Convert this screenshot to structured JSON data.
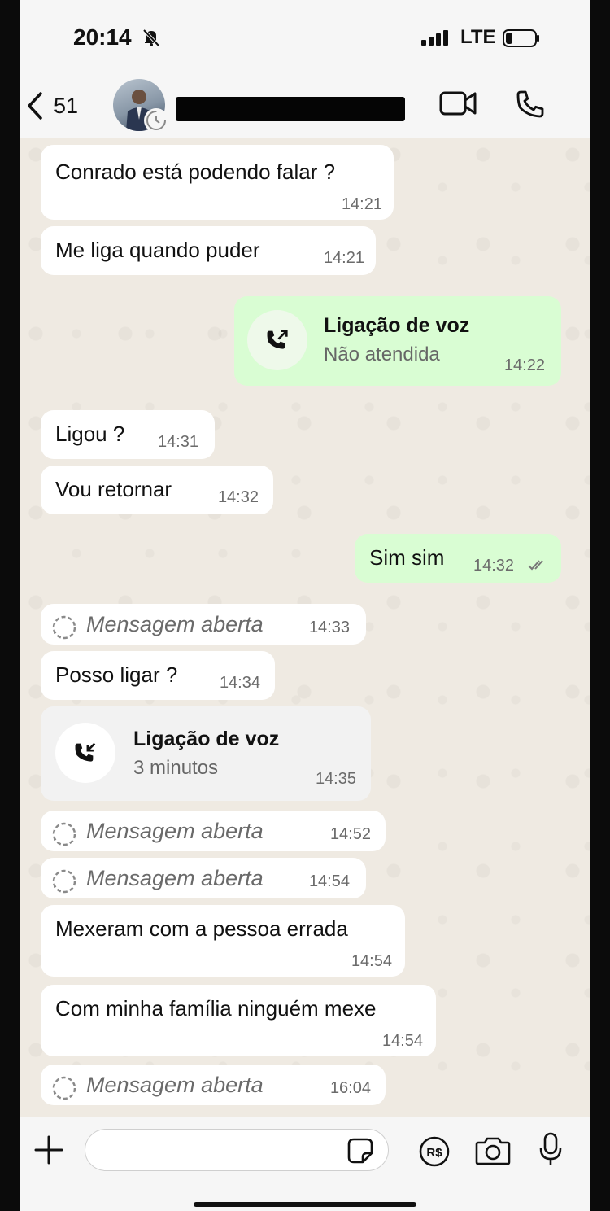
{
  "status_bar": {
    "time": "20:14",
    "network": "LTE"
  },
  "header": {
    "back_count": "51"
  },
  "messages": [
    {
      "type": "text",
      "text": "Conrado está podendo falar ?",
      "time": "14:21"
    },
    {
      "type": "text",
      "text": "Me liga quando puder",
      "time": "14:21"
    },
    {
      "type": "call_out",
      "title": "Ligação de voz",
      "subtitle": "Não atendida",
      "time": "14:22"
    },
    {
      "type": "text",
      "text": "Ligou ?",
      "time": "14:31"
    },
    {
      "type": "text",
      "text": "Vou retornar",
      "time": "14:32"
    },
    {
      "type": "text_out",
      "text": "Sim sim",
      "time": "14:32"
    },
    {
      "type": "view_once",
      "text": "Mensagem aberta",
      "time": "14:33"
    },
    {
      "type": "text",
      "text": "Posso ligar ?",
      "time": "14:34"
    },
    {
      "type": "call_in",
      "title": "Ligação de voz",
      "subtitle": "3 minutos",
      "time": "14:35"
    },
    {
      "type": "view_once",
      "text": "Mensagem aberta",
      "time": "14:52"
    },
    {
      "type": "view_once",
      "text": "Mensagem aberta",
      "time": "14:54"
    },
    {
      "type": "text",
      "text": "Mexeram com a pessoa errada",
      "time": "14:54"
    },
    {
      "type": "text",
      "text": "Com minha família ninguém mexe",
      "time": "14:54"
    },
    {
      "type": "view_once",
      "text": "Mensagem aberta",
      "time": "16:04"
    }
  ],
  "input_bar": {
    "placeholder": "",
    "payment_label": "R$"
  },
  "icons": {
    "status": [
      "bell-off-icon",
      "signal-icon",
      "battery-icon"
    ],
    "header": [
      "chevron-left-icon",
      "video-camera-icon",
      "phone-icon"
    ],
    "messages": [
      "outgoing-call-icon",
      "incoming-call-icon",
      "view-once-icon",
      "double-check-icon"
    ],
    "input": [
      "plus-icon",
      "sticker-icon",
      "payment-icon",
      "camera-icon",
      "microphone-icon"
    ]
  },
  "colors": {
    "incoming_bubble": "#ffffff",
    "outgoing_bubble": "#d9fdd3",
    "chat_background": "#efeae2",
    "bars": "#f6f6f6"
  }
}
